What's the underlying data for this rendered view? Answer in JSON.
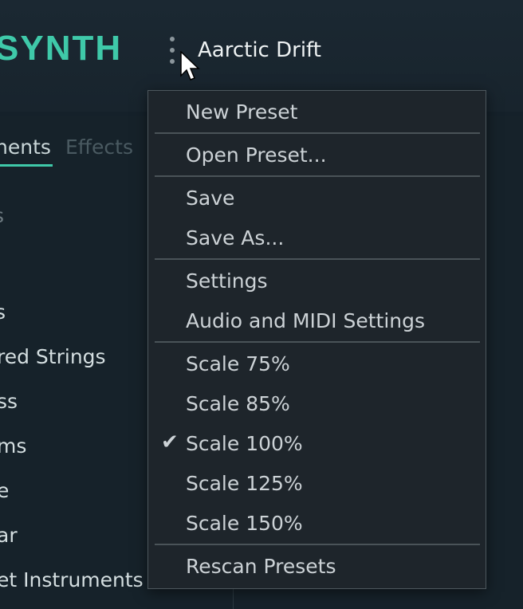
{
  "header": {
    "logo_text": "SYNTH",
    "preset_name": "Aarctic Drift"
  },
  "tabs": [
    {
      "label": "nents",
      "active": true
    },
    {
      "label": "Effects",
      "active": false
    }
  ],
  "sidebar": {
    "items": [
      "s",
      "s",
      "red Strings",
      "ss",
      "ms",
      "e",
      "ar",
      "et Instruments"
    ]
  },
  "menu": {
    "items": [
      "New Preset",
      "Open Preset...",
      "Save",
      "Save As...",
      "Settings",
      "Audio and MIDI Settings",
      "Scale 75%",
      "Scale 85%",
      "Scale 100%",
      "Scale 125%",
      "Scale 150%",
      "Rescan Presets"
    ],
    "checked_item": "Scale 100%",
    "check_glyph": "✔"
  },
  "colors": {
    "accent": "#3fc9a9",
    "menu_bg": "#1e252b",
    "background": "#16222a"
  }
}
